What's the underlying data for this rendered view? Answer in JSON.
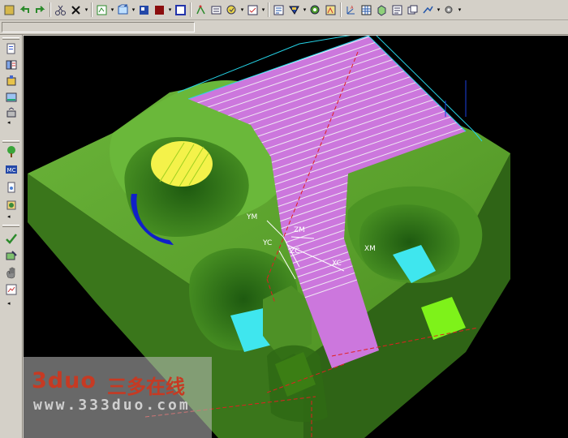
{
  "toolbar": {
    "buttons": [
      {
        "name": "home-icon",
        "dropdown": false
      },
      {
        "name": "undo-icon",
        "dropdown": false
      },
      {
        "name": "redo-icon",
        "dropdown": false
      },
      {
        "sep": true
      },
      {
        "name": "cut-icon",
        "dropdown": false
      },
      {
        "name": "delete-icon",
        "dropdown": true
      },
      {
        "sep": true
      },
      {
        "name": "create-operation-icon",
        "dropdown": true
      },
      {
        "name": "create-geometry-icon",
        "dropdown": true
      },
      {
        "name": "create-method-icon",
        "dropdown": false
      },
      {
        "name": "create-tool-icon",
        "dropdown": true
      },
      {
        "name": "create-program-icon",
        "dropdown": false
      },
      {
        "sep": true
      },
      {
        "name": "generate-path-icon",
        "dropdown": false
      },
      {
        "name": "replay-path-icon",
        "dropdown": false
      },
      {
        "name": "verify-path-icon",
        "dropdown": true
      },
      {
        "name": "list-path-icon",
        "dropdown": true
      },
      {
        "sep": true
      },
      {
        "name": "display-icon",
        "dropdown": false
      },
      {
        "name": "shading-icon",
        "dropdown": true
      },
      {
        "name": "view-icon",
        "dropdown": false
      },
      {
        "name": "fit-icon",
        "dropdown": false
      },
      {
        "sep": true
      },
      {
        "name": "axis-icon",
        "dropdown": false
      },
      {
        "name": "grid-icon",
        "dropdown": false
      },
      {
        "name": "solid-icon",
        "dropdown": false
      },
      {
        "name": "document-icon",
        "dropdown": false
      },
      {
        "name": "window-icon",
        "dropdown": false
      },
      {
        "name": "arrows-icon",
        "dropdown": true
      },
      {
        "name": "settings-icon",
        "dropdown": true
      }
    ]
  },
  "status": {
    "prompt": ""
  },
  "viewport": {
    "axis_labels": {
      "ym": "YM",
      "yc": "YC",
      "zm": "ZM",
      "zc": "ZC",
      "xm": "XM",
      "xc": "XC"
    }
  },
  "watermark": {
    "brand": "3duo",
    "chinese": "三多在线",
    "url": "www.333duo.com"
  },
  "colors": {
    "part_green": "#5a9a28",
    "part_dark": "#2f6414",
    "toolpath_magenta": "#cc77dd",
    "floor_yellow": "#f4f24a",
    "floor_cyan": "#3fe6ee",
    "floor_lime": "#7ef21a",
    "edge_blue": "#1020c8",
    "toolpath_cyan": "#25d4e8"
  }
}
